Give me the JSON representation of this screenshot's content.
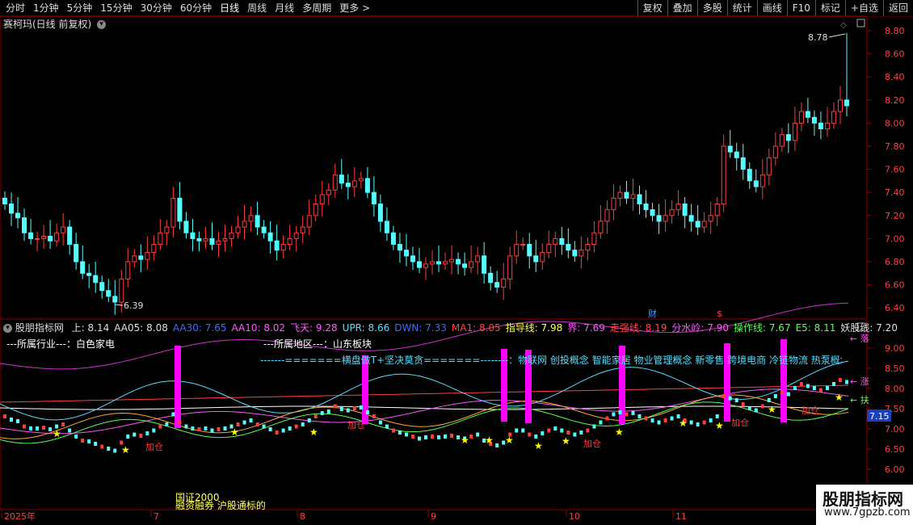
{
  "toolbar": {
    "periods": [
      "分时",
      "1分钟",
      "5分钟",
      "15分钟",
      "30分钟",
      "60分钟",
      "日线",
      "周线",
      "月线",
      "多周期",
      "更多 >"
    ],
    "active_period": "日线",
    "buttons": [
      "复权",
      "叠加",
      "多股",
      "统计",
      "画线",
      "F10",
      "标记",
      "+自选",
      "返回"
    ]
  },
  "stock": {
    "title": "赛柯玛(日线 前复权)",
    "high_label": "8.78",
    "low_label": "6.39"
  },
  "price_axis": [
    "8.80",
    "8.60",
    "8.40",
    "8.20",
    "8.00",
    "7.80",
    "7.60",
    "7.40",
    "7.20",
    "7.00",
    "6.80",
    "6.60",
    "6.40"
  ],
  "indicator_axis": [
    "9.00",
    "8.50",
    "8.00",
    "7.50",
    "7.00",
    "6.50",
    "6.00"
  ],
  "indicator_current": "7.15",
  "indicator": {
    "name": "股朋指标网",
    "values": [
      {
        "label": "上: 8.14",
        "color": "#dddddd"
      },
      {
        "label": "AA05: 8.08",
        "color": "#dddddd"
      },
      {
        "label": "AA30: 7.65",
        "color": "#3b6cff"
      },
      {
        "label": "AA10: 8.02",
        "color": "#ff55ff"
      },
      {
        "label": "飞天: 9.28",
        "color": "#ff55ff"
      },
      {
        "label": "UPR: 8.66",
        "color": "#55ddff"
      },
      {
        "label": "DWN: 7.33",
        "color": "#3b6cff"
      },
      {
        "label": "MA1: 8.05",
        "color": "#ff4444"
      },
      {
        "label": "指导线: 7.98",
        "color": "#ffff55"
      },
      {
        "label": "界: 7.69",
        "color": "#ff55ff"
      },
      {
        "label": "走强线: 8.19",
        "color": "#ff4444"
      },
      {
        "label": "分水岭: 7.90",
        "color": "#ff55ff"
      },
      {
        "label": "操作线: 7.67",
        "color": "#55ff55"
      },
      {
        "label": "E5: 8.11",
        "color": "#55ff55"
      },
      {
        "label": "妖股线: 7.20",
        "color": "#dddddd"
      }
    ]
  },
  "info": {
    "industry": "---所属行业---：白色家电",
    "region": "---所属地区---：山东板块",
    "banner": "-------=======横盘做T+坚决莫贪=======--------：物联网 创投概念 智能家居 物业管理概念 新零售 跨境电商 冷链物流 热泵概念"
  },
  "markers": {
    "cai": "财",
    "warn": "$",
    "buy": "加仓",
    "fall": "落",
    "fu": "扶",
    "up": "涨"
  },
  "notes": [
    "国证2000",
    "融资融券 沪股通标的"
  ],
  "x_axis": [
    "2025年",
    "7",
    "8",
    "9",
    "10",
    "11"
  ],
  "watermark": {
    "title": "股朋指标网",
    "url": "www.7gpzb.com"
  },
  "colors": {
    "up": "#ff3c3c",
    "down": "#54ffff",
    "grid": "#8b0000",
    "magenta": "#ff00ff"
  }
}
